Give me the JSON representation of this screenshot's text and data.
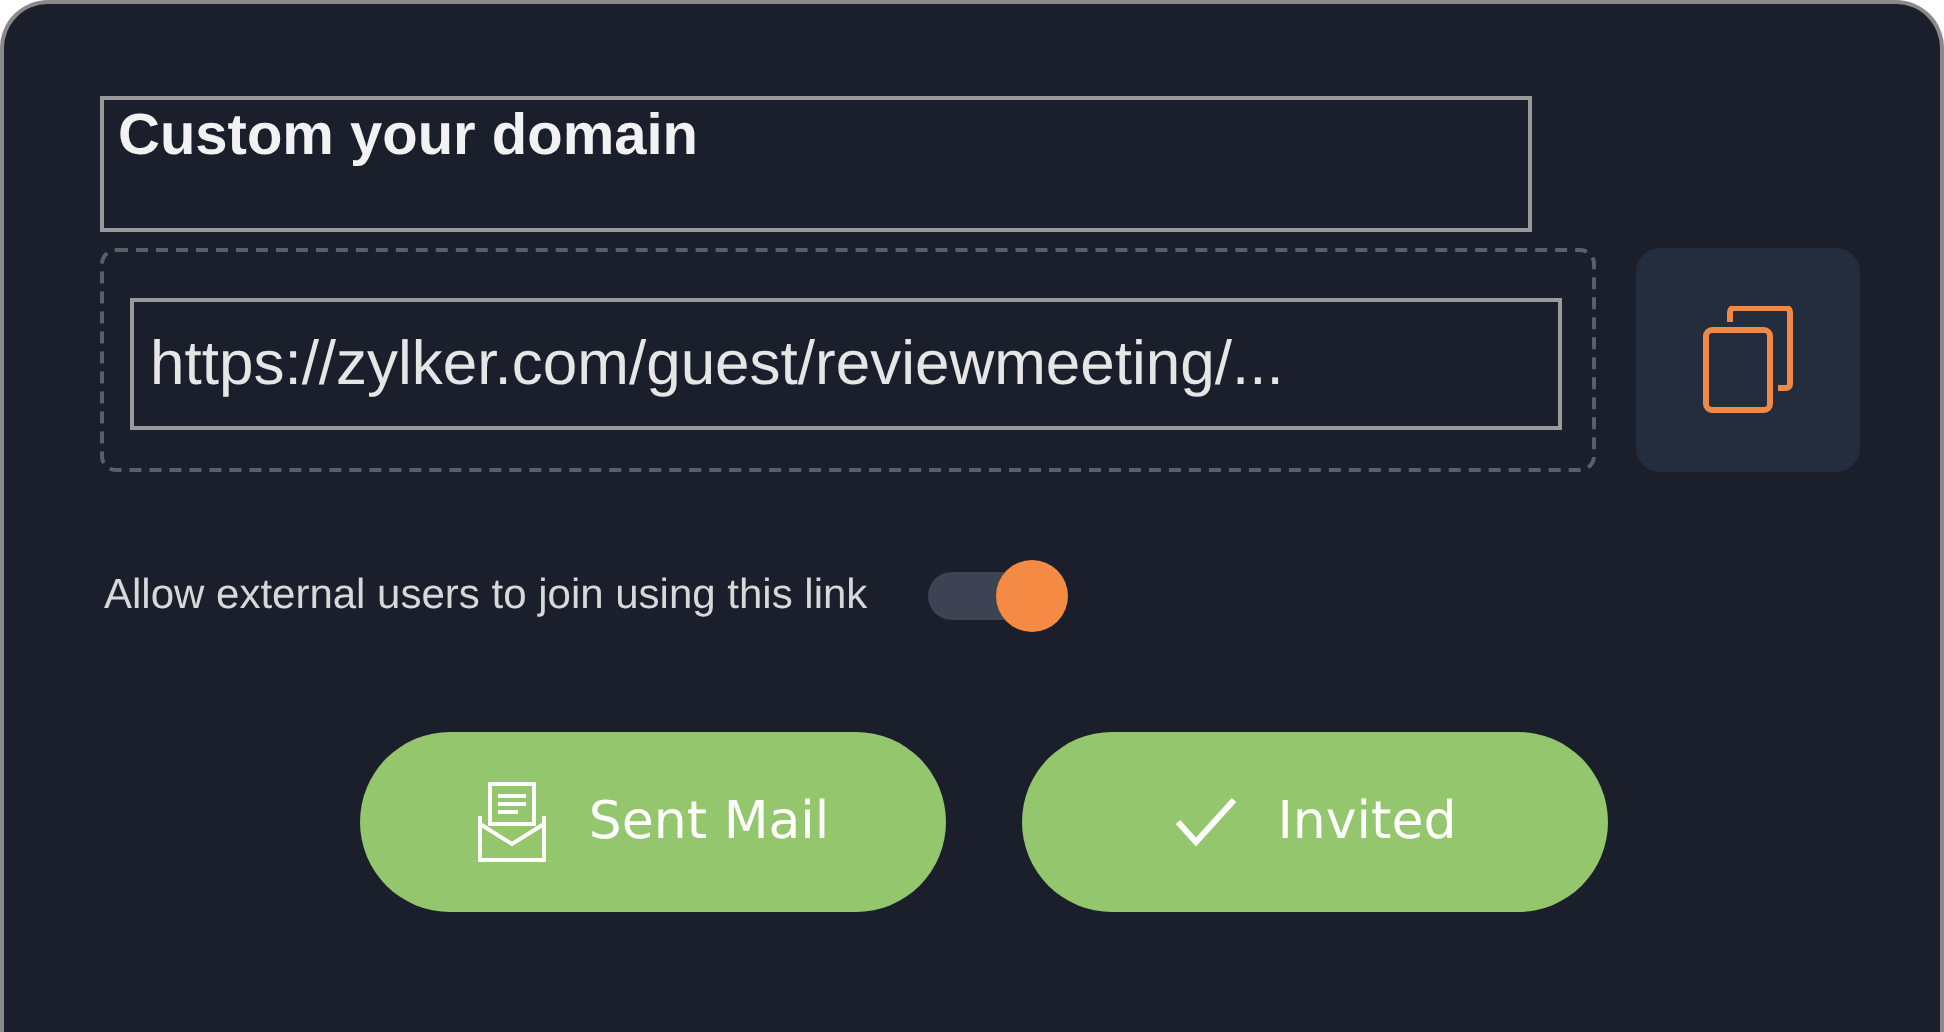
{
  "title": "Custom your domain",
  "link_field": {
    "value": "https://zylker.com/guest/reviewmeeting/..."
  },
  "toggle": {
    "label": "Allow external users to join using this link",
    "on": true
  },
  "buttons": [
    {
      "label": "Sent Mail",
      "kind": "mail"
    },
    {
      "label": "Invited",
      "kind": "check"
    }
  ]
}
